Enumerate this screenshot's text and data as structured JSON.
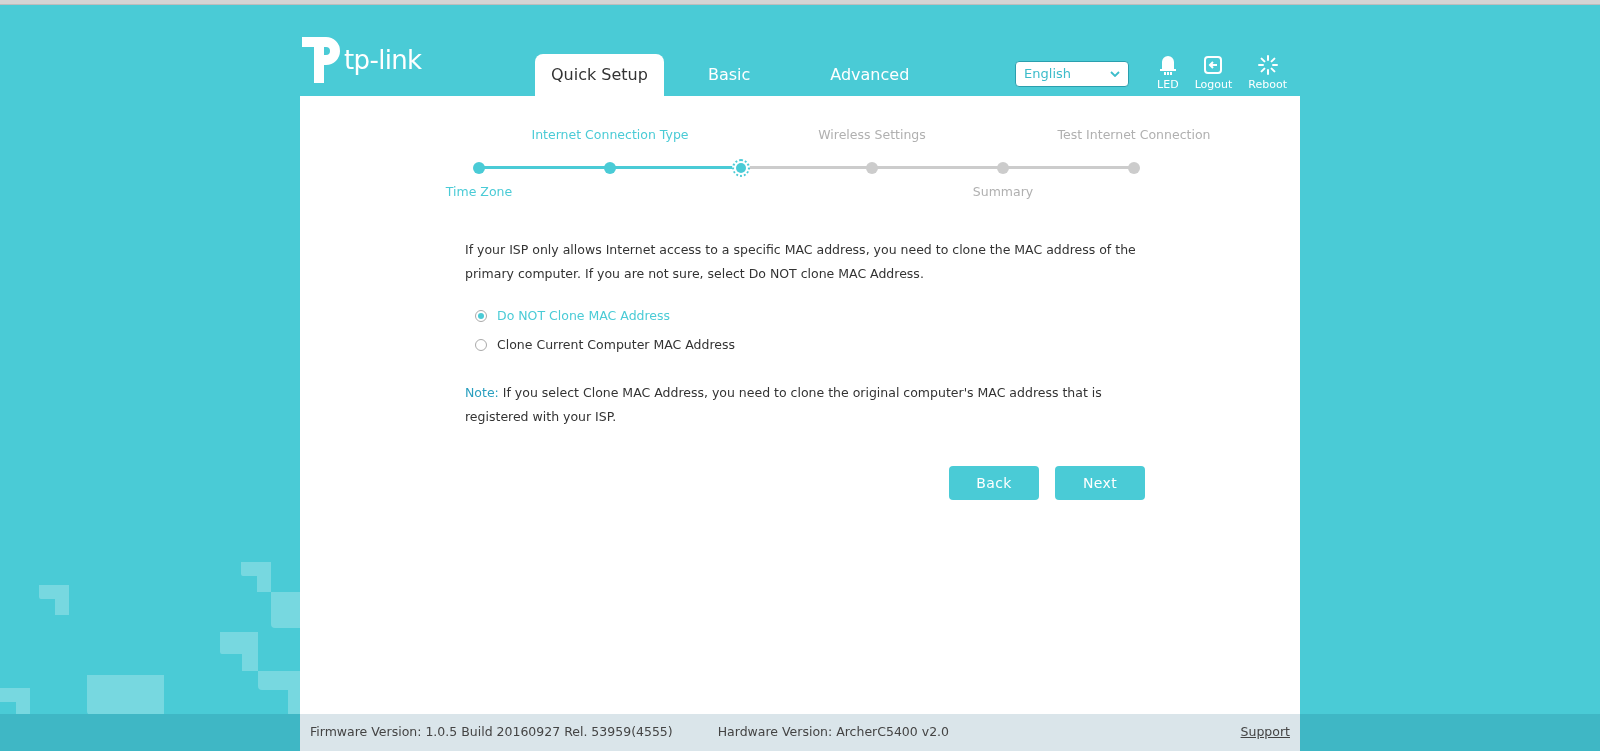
{
  "header": {
    "logo_text": "tp-link",
    "tabs": [
      {
        "label": "Quick Setup",
        "selected": true
      },
      {
        "label": "Basic",
        "selected": false
      },
      {
        "label": "Advanced",
        "selected": false
      }
    ],
    "language": {
      "value": "English"
    },
    "actions": [
      {
        "kind": "led",
        "label": "LED"
      },
      {
        "kind": "logout",
        "label": "Logout"
      },
      {
        "kind": "reboot",
        "label": "Reboot"
      }
    ]
  },
  "stepper": {
    "steps": [
      {
        "label": "Time Zone",
        "completed": true,
        "current": false
      },
      {
        "label": "Internet Connection Type",
        "completed": true,
        "current": false
      },
      {
        "completed": true,
        "current": true
      },
      {
        "label": "Wireless Settings",
        "completed": false,
        "current": false
      },
      {
        "label": "Summary",
        "completed": false,
        "current": false
      },
      {
        "label": "Test Internet Connection",
        "completed": false,
        "current": false
      }
    ]
  },
  "intro": "If your ISP only allows Internet access to a specific MAC address, you need to clone the MAC address of the primary computer. If you are not sure, select Do NOT clone MAC Address.",
  "options": [
    {
      "label": "Do NOT Clone MAC Address",
      "selected": true
    },
    {
      "label": "Clone Current Computer MAC Address",
      "selected": false
    }
  ],
  "note": {
    "label": "Note:",
    "text": "If you select Clone MAC Address, you need to clone the original computer's MAC address that is registered with your ISP."
  },
  "buttons": [
    "Back",
    "Next"
  ],
  "footer": {
    "firmware": "Firmware Version: 1.0.5 Build 20160927 Rel. 53959(4555)",
    "hardware": "Hardware Version: ArcherC5400 v2.0",
    "support": "Support"
  }
}
